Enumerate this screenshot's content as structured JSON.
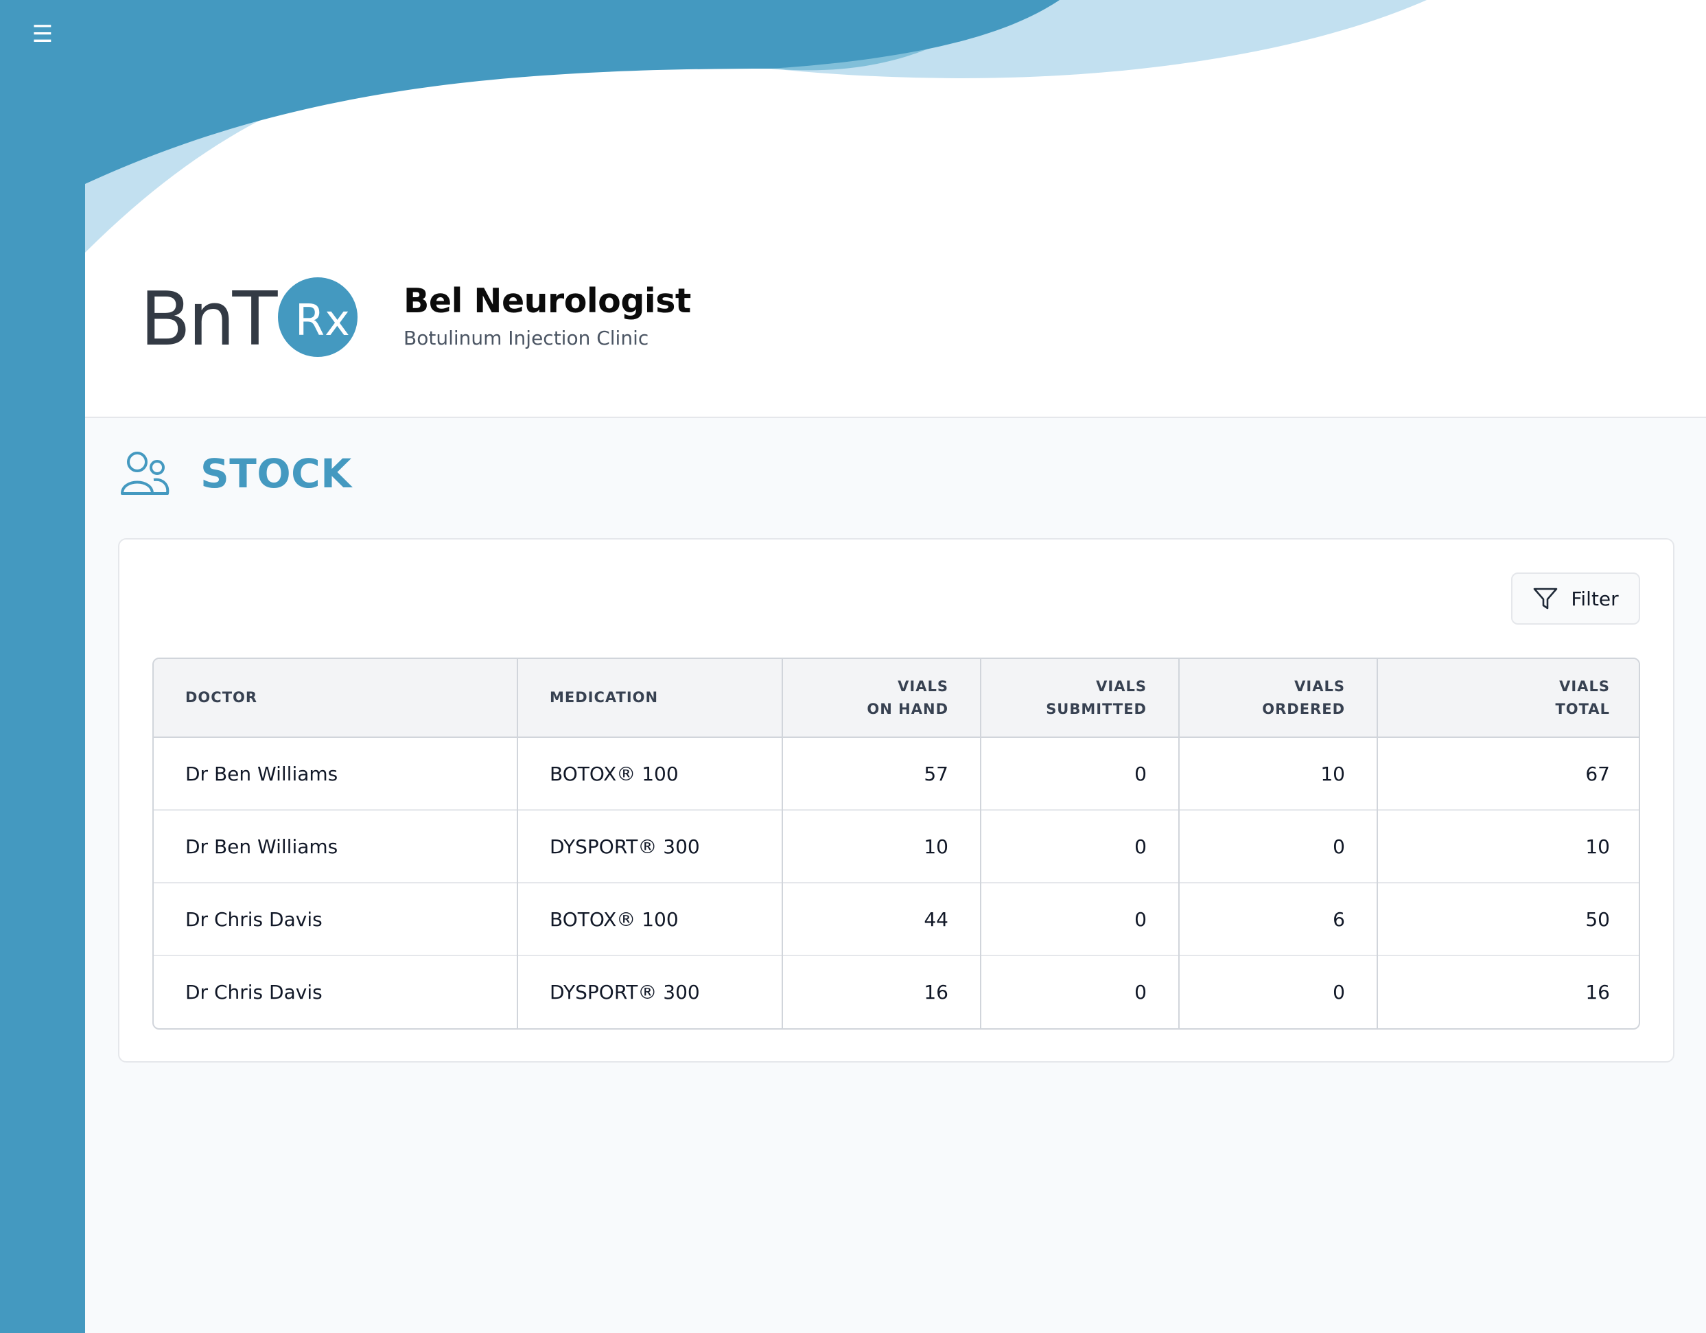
{
  "sidebar": {
    "menu_icon": "☰"
  },
  "header": {
    "logo_text": "BnT",
    "logo_badge": "Rx",
    "title": "Bel Neurologist",
    "subtitle": "Botulinum Injection Clinic"
  },
  "page": {
    "title": "STOCK",
    "icon": "users-icon"
  },
  "toolbar": {
    "filter_label": "Filter",
    "filter_icon": "funnel-icon"
  },
  "table": {
    "columns": [
      {
        "line1": "DOCTOR",
        "line2": ""
      },
      {
        "line1": "MEDICATION",
        "line2": ""
      },
      {
        "line1": "VIALS",
        "line2": "ON HAND"
      },
      {
        "line1": "VIALS",
        "line2": "SUBMITTED"
      },
      {
        "line1": "VIALS",
        "line2": "ORDERED"
      },
      {
        "line1": "VIALS",
        "line2": "TOTAL"
      }
    ],
    "rows": [
      {
        "doctor": "Dr Ben Williams",
        "medication": "BOTOX® 100",
        "on_hand": "57",
        "submitted": "0",
        "ordered": "10",
        "total": "67"
      },
      {
        "doctor": "Dr Ben Williams",
        "medication": "DYSPORT® 300",
        "on_hand": "10",
        "submitted": "0",
        "ordered": "0",
        "total": "10"
      },
      {
        "doctor": "Dr Chris Davis",
        "medication": "BOTOX® 100",
        "on_hand": "44",
        "submitted": "0",
        "ordered": "6",
        "total": "50"
      },
      {
        "doctor": "Dr Chris Davis",
        "medication": "DYSPORT® 300",
        "on_hand": "16",
        "submitted": "0",
        "ordered": "0",
        "total": "16"
      }
    ]
  },
  "colors": {
    "brand": "#4499c0",
    "brand_light": "#c2e0f0",
    "brand_mid": "#81bfd9",
    "logo_dark": "#333a44"
  }
}
